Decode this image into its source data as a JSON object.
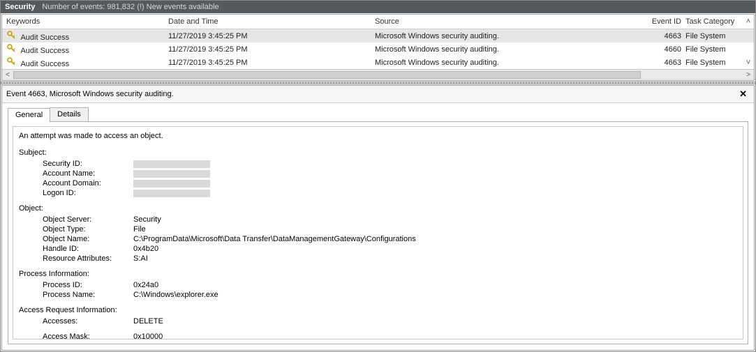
{
  "titlebar": {
    "log_name": "Security",
    "events_label": "Number of events:",
    "events_count": "981,832",
    "new_events": "(!) New events available"
  },
  "columns": {
    "keywords": "Keywords",
    "date": "Date and Time",
    "source": "Source",
    "eventid": "Event ID",
    "taskcat": "Task Category"
  },
  "rows": [
    {
      "keywords": "Audit Success",
      "date": "11/27/2019 3:45:25 PM",
      "source": "Microsoft Windows security auditing.",
      "eventid": "4663",
      "taskcat": "File System"
    },
    {
      "keywords": "Audit Success",
      "date": "11/27/2019 3:45:25 PM",
      "source": "Microsoft Windows security auditing.",
      "eventid": "4660",
      "taskcat": "File System"
    },
    {
      "keywords": "Audit Success",
      "date": "11/27/2019 3:45:25 PM",
      "source": "Microsoft Windows security auditing.",
      "eventid": "4663",
      "taskcat": "File System"
    }
  ],
  "detail": {
    "title": "Event 4663, Microsoft Windows security auditing.",
    "tabs": {
      "general": "General",
      "details": "Details"
    },
    "message": "An attempt was made to access an object.",
    "subject": {
      "heading": "Subject:",
      "security_id_k": "Security ID:",
      "account_name_k": "Account Name:",
      "account_domain_k": "Account Domain:",
      "logon_id_k": "Logon ID:"
    },
    "object": {
      "heading": "Object:",
      "server_k": "Object Server:",
      "server_v": "Security",
      "type_k": "Object Type:",
      "type_v": "File",
      "name_k": "Object Name:",
      "name_v": "C:\\ProgramData\\Microsoft\\Data Transfer\\DataManagementGateway\\Configurations",
      "handle_k": "Handle ID:",
      "handle_v": "0x4b20",
      "resattr_k": "Resource Attributes:",
      "resattr_v": "S:AI"
    },
    "process": {
      "heading": "Process Information:",
      "pid_k": "Process ID:",
      "pid_v": "0x24a0",
      "pname_k": "Process Name:",
      "pname_v": "C:\\Windows\\explorer.exe"
    },
    "access": {
      "heading": "Access Request Information:",
      "accesses_k": "Accesses:",
      "accesses_v": "DELETE",
      "mask_k": "Access Mask:",
      "mask_v": "0x10000"
    }
  }
}
